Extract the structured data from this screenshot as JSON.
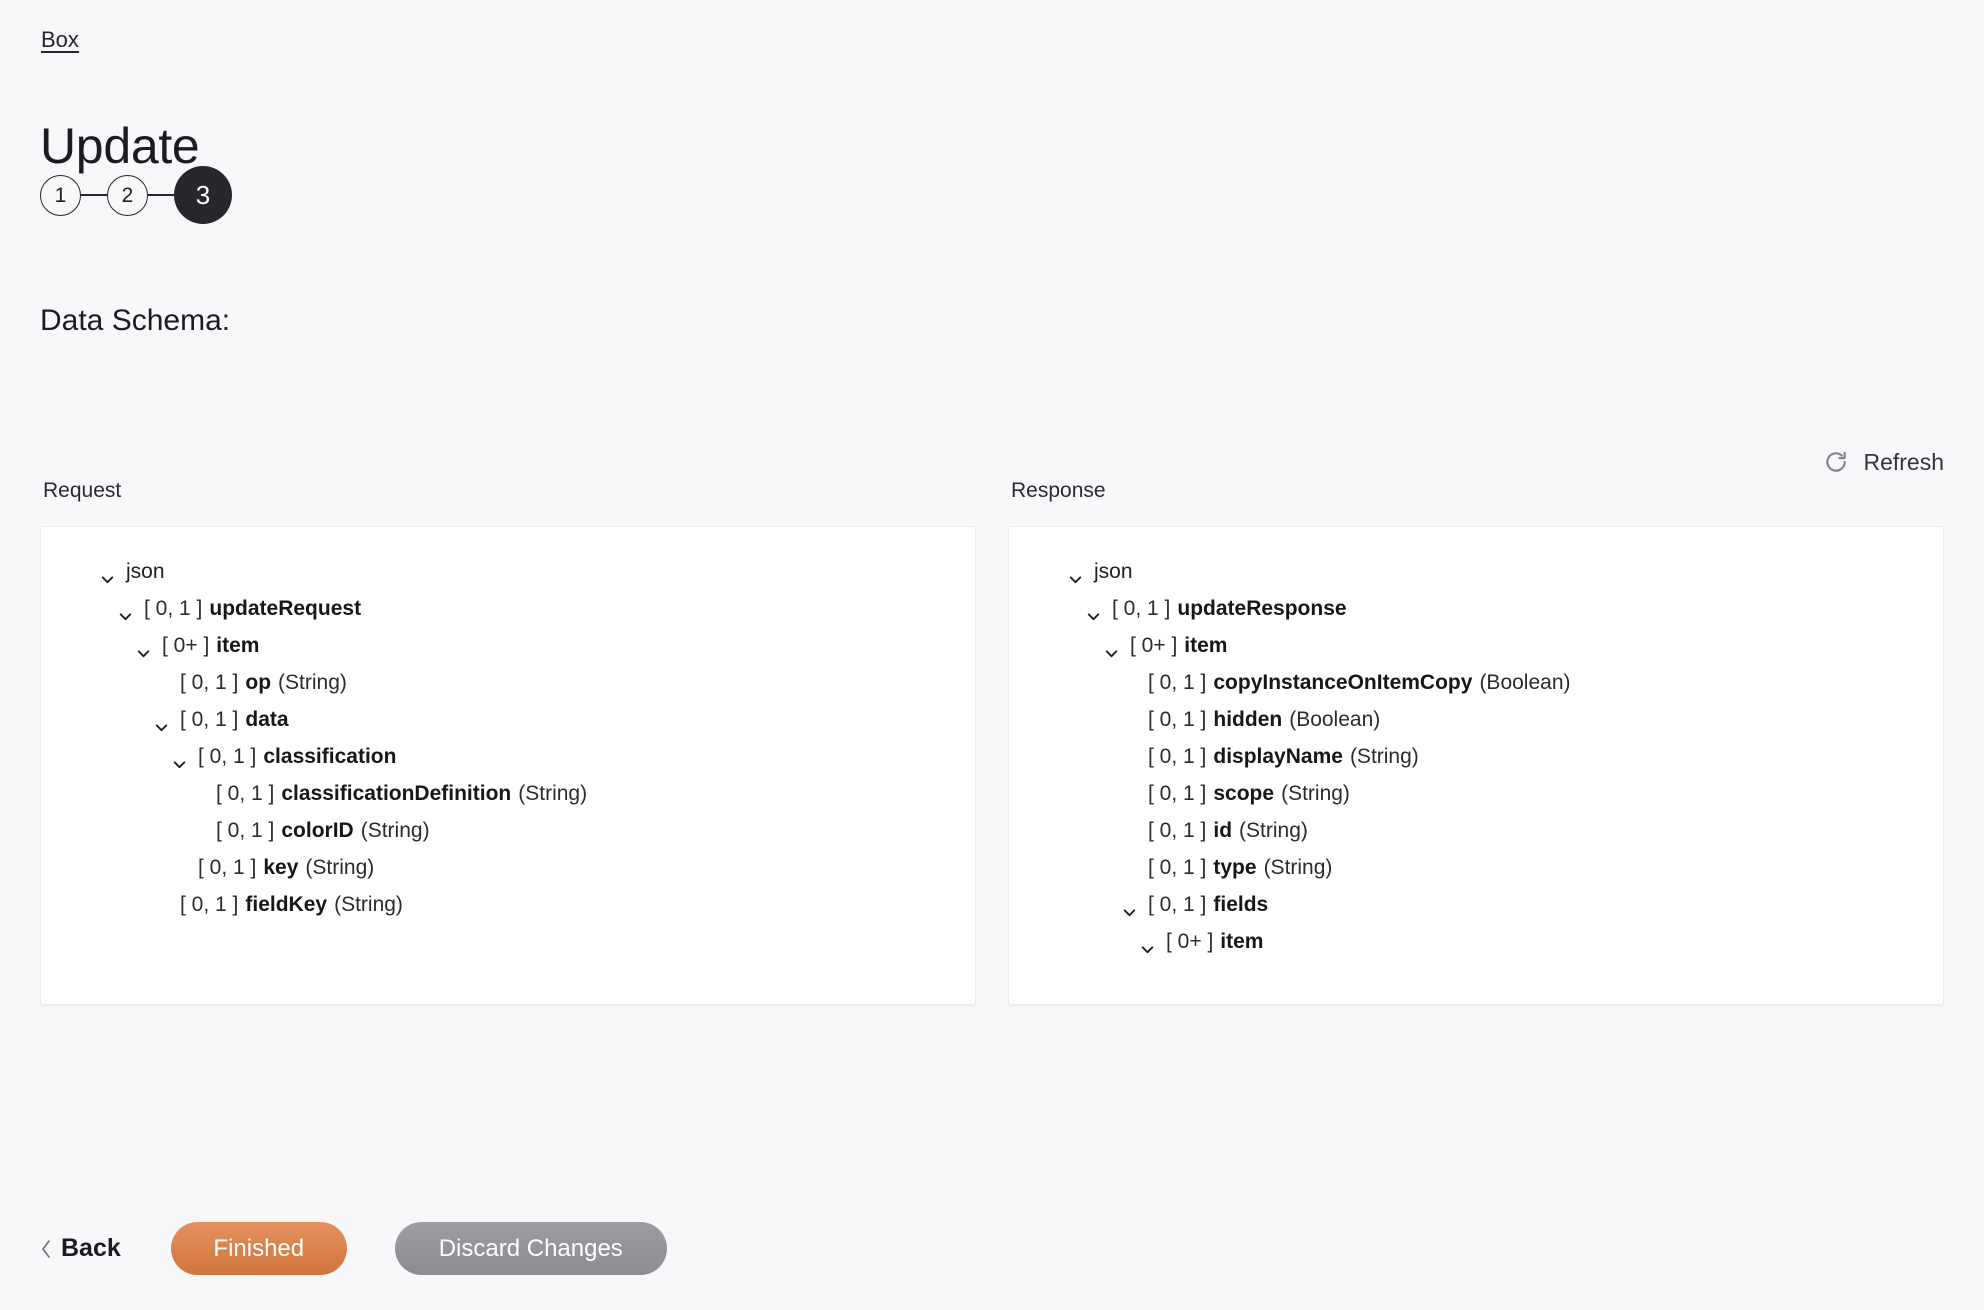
{
  "breadcrumb": {
    "label": "Box"
  },
  "header": {
    "title": "Update"
  },
  "stepper": {
    "steps": [
      {
        "label": "1",
        "active": false
      },
      {
        "label": "2",
        "active": false
      },
      {
        "label": "3",
        "active": true
      }
    ]
  },
  "section": {
    "heading": "Data Schema:"
  },
  "refresh": {
    "label": "Refresh",
    "icon": "refresh-icon"
  },
  "request": {
    "column_label": "Request",
    "rows": [
      {
        "indent": 0,
        "chevron": true,
        "cardinality": "",
        "name": "json",
        "type": ""
      },
      {
        "indent": 1,
        "chevron": true,
        "cardinality": "[ 0, 1 ]",
        "name": "updateRequest",
        "type": ""
      },
      {
        "indent": 2,
        "chevron": true,
        "cardinality": "[ 0+ ]",
        "name": "item",
        "type": ""
      },
      {
        "indent": 3,
        "chevron": false,
        "cardinality": "[ 0, 1 ]",
        "name": "op",
        "type": "(String)"
      },
      {
        "indent": 3,
        "chevron": true,
        "cardinality": "[ 0, 1 ]",
        "name": "data",
        "type": ""
      },
      {
        "indent": 4,
        "chevron": true,
        "cardinality": "[ 0, 1 ]",
        "name": "classification",
        "type": ""
      },
      {
        "indent": 5,
        "chevron": false,
        "cardinality": "[ 0, 1 ]",
        "name": "classificationDefinition",
        "type": "(String)"
      },
      {
        "indent": 5,
        "chevron": false,
        "cardinality": "[ 0, 1 ]",
        "name": "colorID",
        "type": "(String)"
      },
      {
        "indent": 4,
        "chevron": false,
        "cardinality": "[ 0, 1 ]",
        "name": "key",
        "type": "(String)"
      },
      {
        "indent": 3,
        "chevron": false,
        "cardinality": "[ 0, 1 ]",
        "name": "fieldKey",
        "type": "(String)"
      }
    ]
  },
  "response": {
    "column_label": "Response",
    "rows": [
      {
        "indent": 0,
        "chevron": true,
        "cardinality": "",
        "name": "json",
        "type": ""
      },
      {
        "indent": 1,
        "chevron": true,
        "cardinality": "[ 0, 1 ]",
        "name": "updateResponse",
        "type": ""
      },
      {
        "indent": 2,
        "chevron": true,
        "cardinality": "[ 0+ ]",
        "name": "item",
        "type": ""
      },
      {
        "indent": 3,
        "chevron": false,
        "cardinality": "[ 0, 1 ]",
        "name": "copyInstanceOnItemCopy",
        "type": "(Boolean)"
      },
      {
        "indent": 3,
        "chevron": false,
        "cardinality": "[ 0, 1 ]",
        "name": "hidden",
        "type": "(Boolean)"
      },
      {
        "indent": 3,
        "chevron": false,
        "cardinality": "[ 0, 1 ]",
        "name": "displayName",
        "type": "(String)"
      },
      {
        "indent": 3,
        "chevron": false,
        "cardinality": "[ 0, 1 ]",
        "name": "scope",
        "type": "(String)"
      },
      {
        "indent": 3,
        "chevron": false,
        "cardinality": "[ 0, 1 ]",
        "name": "id",
        "type": "(String)"
      },
      {
        "indent": 3,
        "chevron": false,
        "cardinality": "[ 0, 1 ]",
        "name": "type",
        "type": "(String)"
      },
      {
        "indent": 3,
        "chevron": true,
        "cardinality": "[ 0, 1 ]",
        "name": "fields",
        "type": ""
      },
      {
        "indent": 4,
        "chevron": true,
        "cardinality": "[ 0+ ]",
        "name": "item",
        "type": ""
      }
    ]
  },
  "footer": {
    "back_label": "Back",
    "finished_label": "Finished",
    "discard_label": "Discard Changes"
  },
  "colors": {
    "page_background": "#f8f8fa",
    "panel_background": "#ffffff",
    "primary_button": "#d9814c",
    "secondary_button": "#949399",
    "step_active": "#26262b",
    "text": "#1f1f23"
  }
}
